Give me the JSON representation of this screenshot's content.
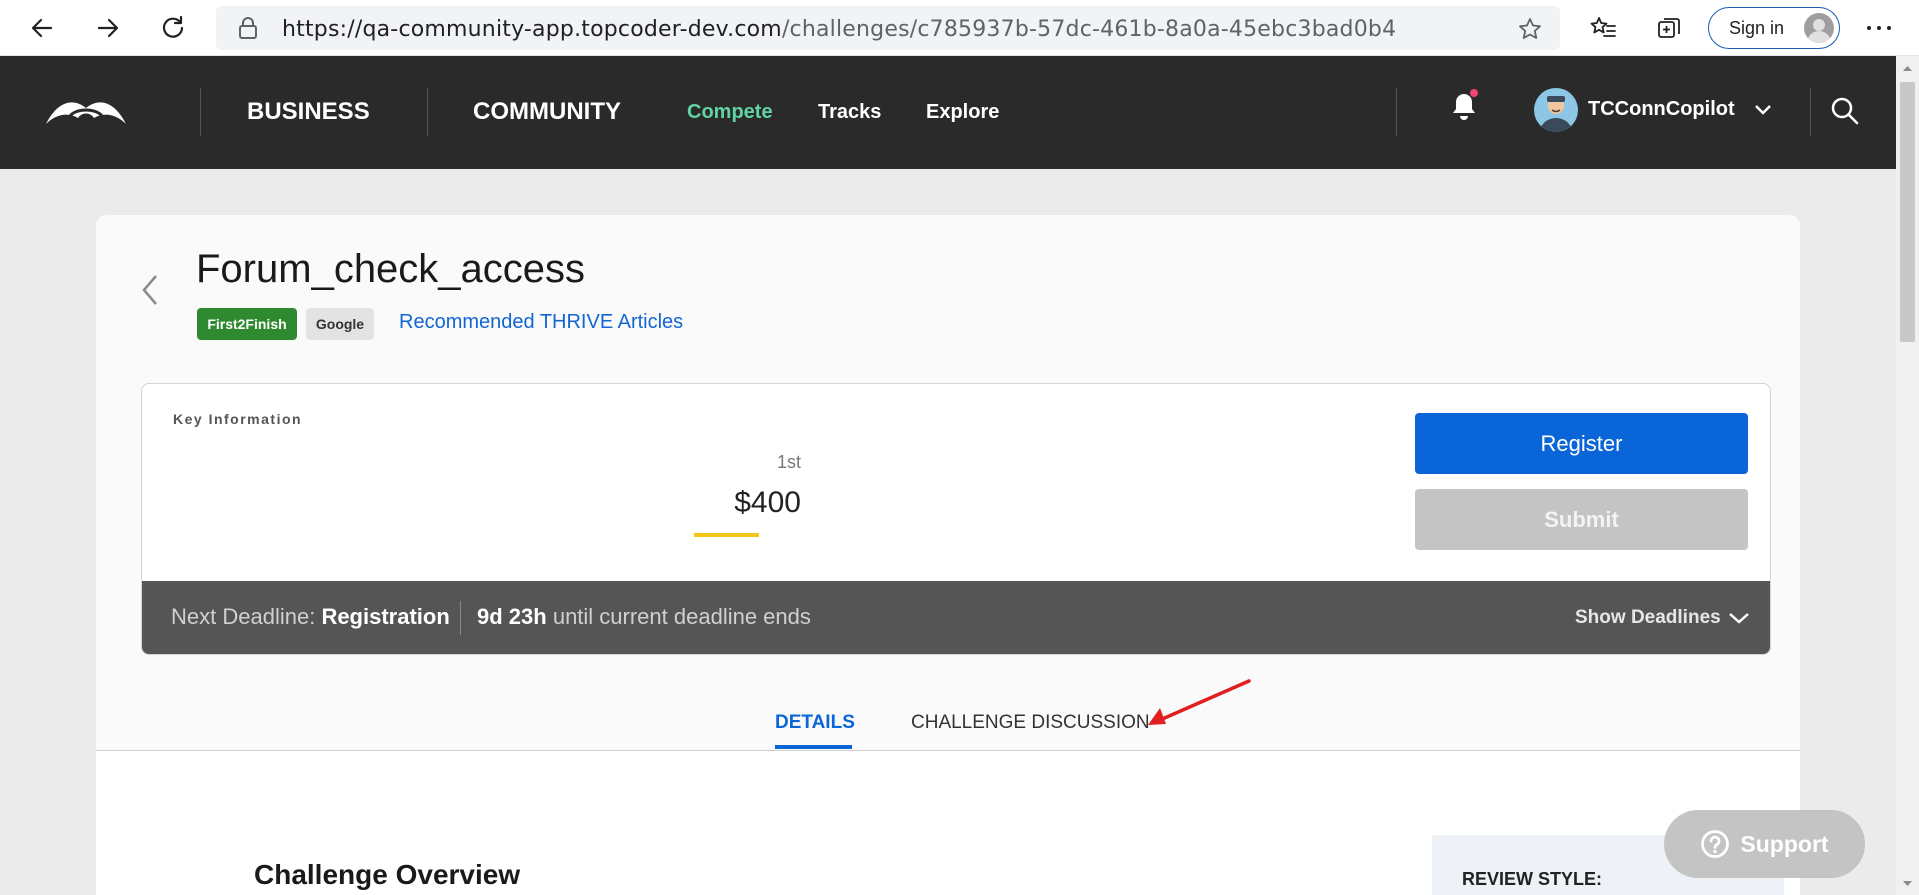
{
  "browser": {
    "url_host": "https://qa-community-app.topcoder-dev.com",
    "url_path": "/challenges/c785937b-57dc-461b-8a0a-45ebc3bad0b4",
    "signin_label": "Sign in"
  },
  "header": {
    "business": "BUSINESS",
    "community": "COMMUNITY",
    "compete": "Compete",
    "tracks": "Tracks",
    "explore": "Explore",
    "username": "TCConnCopilot",
    "accent_color": "#5fd3a5"
  },
  "challenge": {
    "title": "Forum_check_access",
    "tags": [
      "First2Finish",
      "Google"
    ],
    "thrive_link": "Recommended THRIVE Articles",
    "key_info_label": "Key Information",
    "prize_place": "1st",
    "prize_amount": "$400",
    "register_label": "Register",
    "submit_label": "Submit",
    "next_deadline_label": "Next Deadline:",
    "next_deadline_value": "Registration",
    "time_left": "9d 23h",
    "time_left_suffix": "until current deadline ends",
    "show_deadlines": "Show Deadlines"
  },
  "tabs": {
    "details": "DETAILS",
    "discussion": "CHALLENGE DISCUSSION"
  },
  "overview": {
    "heading": "Challenge Overview",
    "review_style": "REVIEW STYLE:"
  },
  "support": {
    "label": "Support"
  }
}
